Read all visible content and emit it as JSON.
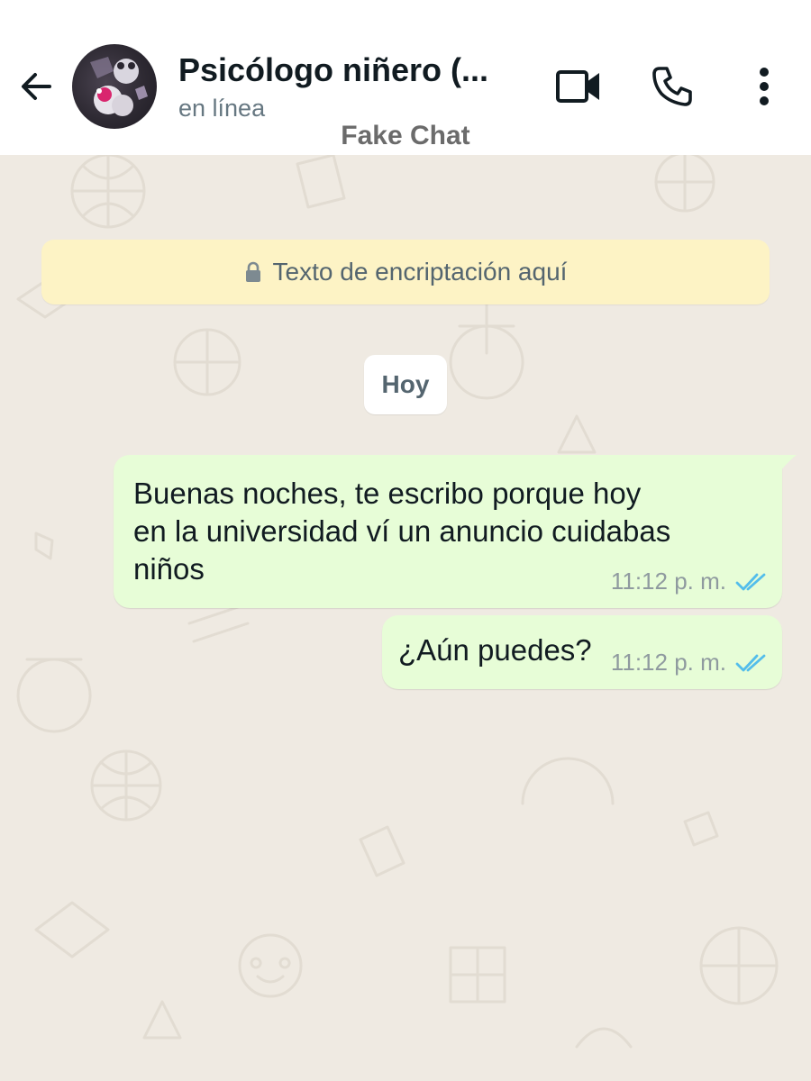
{
  "header": {
    "contact_name": "Psicólogo niñero (...",
    "status": "en línea",
    "watermark": "Fake Chat",
    "icons": {
      "back": "arrow-left-icon",
      "video": "video-camera-icon",
      "call": "phone-icon",
      "menu": "more-vertical-icon"
    }
  },
  "chat": {
    "encryption_text": "Texto de encriptación aquí",
    "date_chip": "Hoy",
    "messages": [
      {
        "text": "Buenas noches, te escribo porque hoy\nen la universidad ví un anuncio cuidabas\nniños",
        "time": "11:12 p. m.",
        "status": "read"
      },
      {
        "text": "¿Aún puedes?",
        "time": "11:12 p. m.",
        "status": "read"
      }
    ]
  },
  "colors": {
    "outgoing_bubble": "#e7fdd7",
    "chat_background": "#efeae2",
    "encryption_banner": "#fdf3c5",
    "read_ticks": "#53bdeb"
  }
}
